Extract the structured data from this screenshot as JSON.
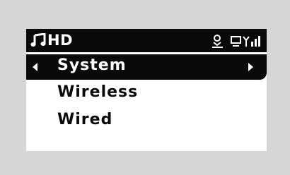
{
  "status_bar": {
    "source_label": "HD",
    "icons": [
      "music-note-icon",
      "user-icon",
      "wifi-signal-icon"
    ]
  },
  "menu": {
    "items": [
      {
        "label": "System",
        "selected": true
      },
      {
        "label": "Wireless",
        "selected": false
      },
      {
        "label": "Wired",
        "selected": false
      }
    ]
  },
  "colors": {
    "background": "#d6d6d6",
    "screen": "#ffffff",
    "ink": "#0a0a0a"
  }
}
